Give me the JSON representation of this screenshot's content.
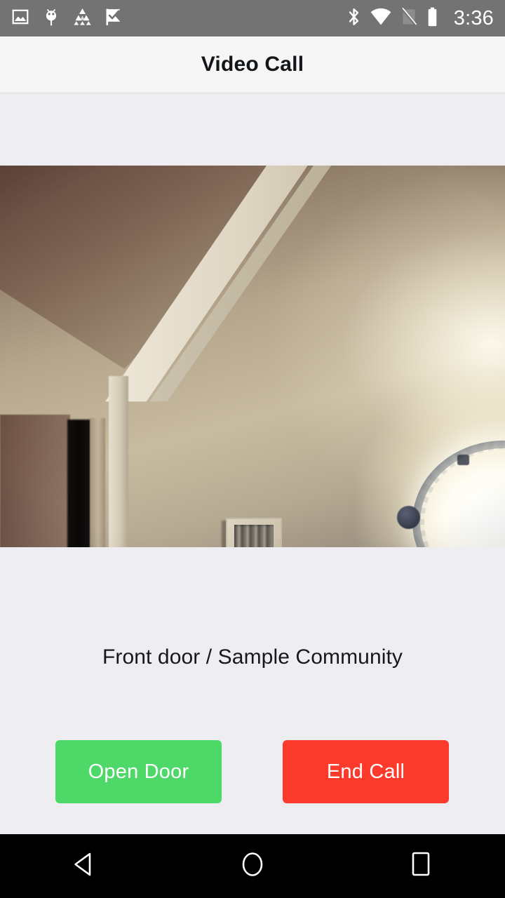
{
  "status_bar": {
    "time": "3:36",
    "background_color": "#737373",
    "left_icons": [
      {
        "name": "screenshot-image-icon",
        "label": "Screenshot"
      },
      {
        "name": "android-debug-bug-icon",
        "label": "Debug"
      },
      {
        "name": "triangle-grid-icon",
        "label": "Triangles"
      },
      {
        "name": "checkmark-flag-icon",
        "label": "Check Flag"
      }
    ],
    "right_icons": [
      {
        "name": "bluetooth-icon",
        "label": "Bluetooth"
      },
      {
        "name": "wifi-icon",
        "label": "Wi-Fi"
      },
      {
        "name": "cellular-no-sim-icon",
        "label": "No SIM"
      },
      {
        "name": "battery-full-icon",
        "label": "Battery Full"
      }
    ]
  },
  "app_bar": {
    "title": "Video Call",
    "background_color": "#F6F6F6",
    "title_color": "#14171A"
  },
  "video": {
    "scene_description": "Live doorbell camera feed showing a hallway wall with an air vent and a lit ceiling lamp beside an open doorway",
    "is_live": true
  },
  "caller": {
    "label": "Front door / Sample Community"
  },
  "actions": {
    "open_door_label": "Open Door",
    "open_door_color": "#4ED868",
    "end_call_label": "End Call",
    "end_call_color": "#FB3A2B"
  },
  "nav_bar": {
    "background_color": "#000000",
    "buttons": [
      {
        "name": "nav-back-button",
        "label": "Back"
      },
      {
        "name": "nav-home-button",
        "label": "Home"
      },
      {
        "name": "nav-recents-button",
        "label": "Recents"
      }
    ]
  },
  "page": {
    "background_color": "#EEEEF2"
  }
}
